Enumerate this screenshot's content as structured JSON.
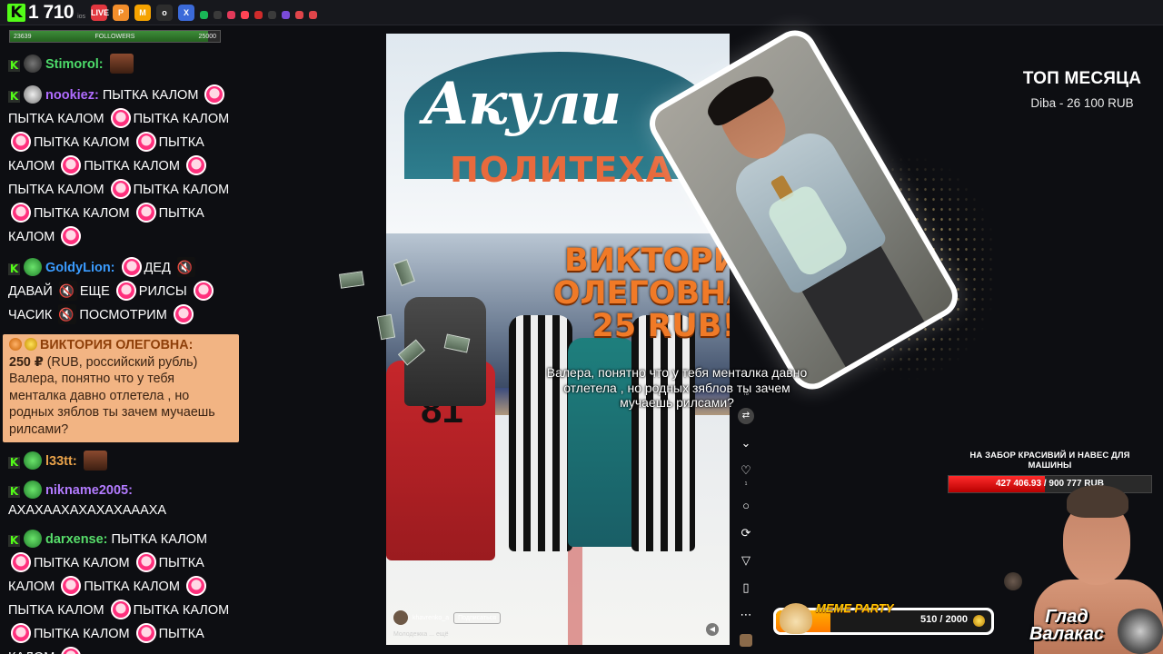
{
  "topbar": {
    "viewers": "1 710",
    "viewers_sub": "ios",
    "apps": [
      {
        "name": "live-app-icon",
        "label": "LIVE",
        "color": "#e2373f"
      },
      {
        "name": "p-app-icon",
        "label": "P",
        "color": "#f28e2b"
      },
      {
        "name": "m-app-icon",
        "label": "M",
        "color": "#f5a300"
      },
      {
        "name": "o-app-icon",
        "label": "o",
        "color": "#2d2d2d"
      },
      {
        "name": "x-app-icon",
        "label": "X",
        "color": "#3b6ad9"
      }
    ]
  },
  "followers": {
    "label": "FOLLOWERS",
    "current": "23639",
    "goal": "25000",
    "progress": 0.945
  },
  "chat": {
    "messages": [
      {
        "nick": "Stimorol:",
        "color": "#4ddc6a",
        "text": ""
      },
      {
        "nick": "nookiez:",
        "color": "#b06cff",
        "text": "ПЫТКА КАЛОМ"
      },
      {
        "nick": "GoldyLion:",
        "color": "#3b9cff",
        "text": "ДЕД"
      },
      {
        "nick": "l33tt:",
        "color": "#e8a24a",
        "text": ""
      },
      {
        "nick": "nikname2005:",
        "color": "#b37bff",
        "text": "АХАХААХАХАХАХАААХА"
      },
      {
        "nick": "darxense:",
        "color": "#57dd6a",
        "text": "ПЫТКА КАЛОМ"
      }
    ],
    "spam_word": "ПЫТКА",
    "spam_word2": "КАЛОМ",
    "goldy_words": [
      "ДАВАЙ",
      "ЕЩЕ",
      "РИЛСЫ",
      "ЧАСИК",
      "ПОСМОТРИМ"
    ],
    "donation": {
      "title": "ВИКТОРИЯ ОЛЕГОВНА:",
      "amount": "250 ₽",
      "currency": "(RUB, российский рубль)",
      "text": "Валера, понятно что у тебя менталка давно отлетела , но родных зяблов ты зачем мучаешь рилсами?"
    }
  },
  "video": {
    "banner_big": "Акули",
    "banner_sub": "ПОЛИТЕХА",
    "overlay_title": "ВИКТОРИЯ ОЛЕГОВНА - 25 RUB!",
    "jersey": "81",
    "author": "khavrenko_a",
    "subscribe": "Подписаться",
    "caption": "Молодежка ... ещё",
    "side_counts": [
      "78",
      "1"
    ]
  },
  "alert": {
    "text": "Валера, понятно что у тебя менталка давно отлетела , но родных зяблов ты зачем мучаешь рилсами?"
  },
  "top_month": {
    "title": "ТОП МЕСЯЦА",
    "value": "Diba - 26 100 RUB"
  },
  "goal": {
    "title": "НА ЗАБОР КРАСИВИЙ И НАВЕС ДЛЯ МАШИНЫ",
    "text": "427 406.93 / 900 777 RUB",
    "progress": 0.4745
  },
  "meme_party": {
    "label": "MEME PARTY",
    "count": "510 / 2000",
    "progress": 0.255
  },
  "streamer": {
    "name": "Глад Валакас"
  }
}
